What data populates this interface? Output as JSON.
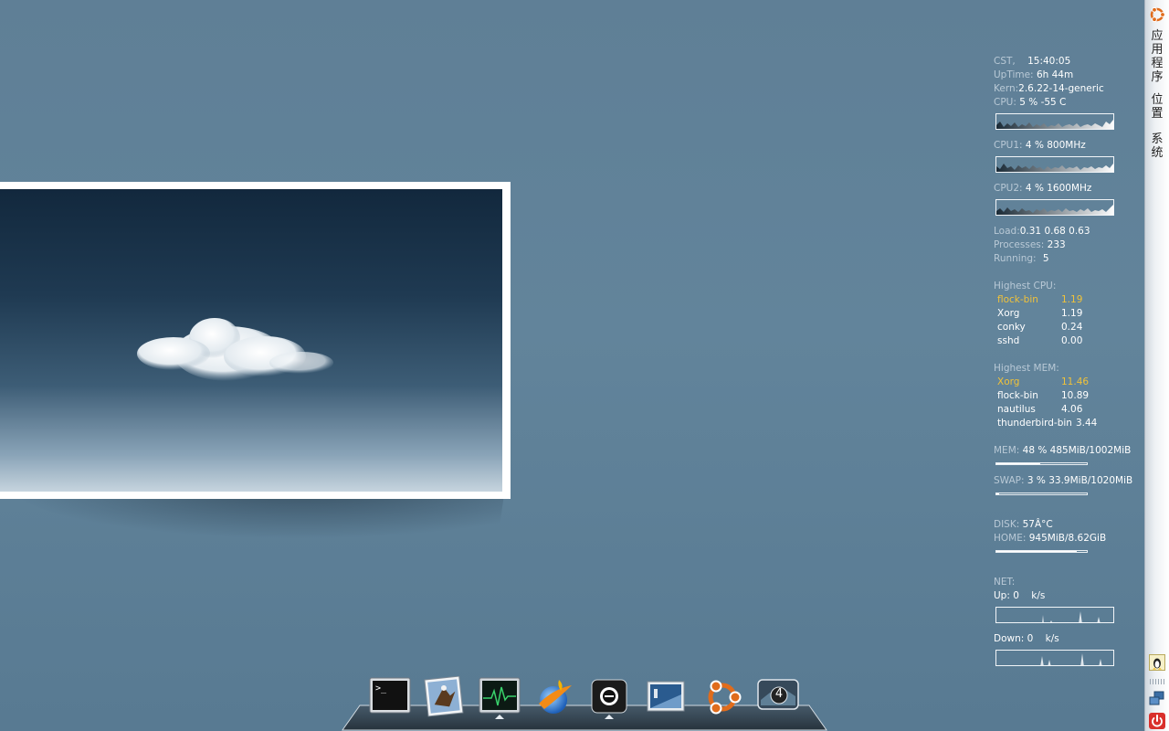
{
  "conky": {
    "clock_label": "CST,",
    "clock_value": "15:40:05",
    "uptime_label": "UpTime:",
    "uptime_value": "6h 44m",
    "kern_label": "Kern:",
    "kern_value": "2.6.22-14-generic",
    "cpu_label": "CPU:",
    "cpu_value": "5  % -55  C",
    "cpu1_label": "CPU1:",
    "cpu1_value": "4  %  800MHz",
    "cpu2_label": "CPU2:",
    "cpu2_value": "4  %  1600MHz",
    "load_label": "Load:",
    "load_value": "0.31 0.68 0.63",
    "processes_label": "Processes:",
    "processes_value": "233",
    "running_label": "Running:",
    "running_value": "5",
    "highest_cpu_label": "Highest CPU:",
    "highest_cpu": [
      {
        "name": "flock-bin",
        "value": "1.19"
      },
      {
        "name": "Xorg",
        "value": "1.19"
      },
      {
        "name": "conky",
        "value": "0.24"
      },
      {
        "name": "sshd",
        "value": "0.00"
      }
    ],
    "highest_mem_label": "Highest MEM:",
    "highest_mem": [
      {
        "name": "Xorg",
        "value": "11.46"
      },
      {
        "name": "flock-bin",
        "value": "10.89"
      },
      {
        "name": "nautilus",
        "value": "4.06"
      },
      {
        "name": "thunderbird-bin",
        "value": "3.44"
      }
    ],
    "mem_label": "MEM:",
    "mem_value": "48 % 485MiB/1002MiB",
    "mem_fraction": 0.48,
    "swap_label": "SWAP:",
    "swap_value": "3  % 33.9MiB/1020MiB",
    "swap_fraction": 0.03,
    "disk_label": "DISK:",
    "disk_value": "57Â°C",
    "home_label": "HOME:",
    "home_value": "945MiB/8.62GiB",
    "home_fraction": 0.89,
    "net_label": "NET:",
    "up_label": "Up: 0",
    "up_unit": "k/s",
    "down_label": "Down: 0",
    "down_unit": "k/s"
  },
  "panel": {
    "menu_applications": "应用程序",
    "menu_places": "位置",
    "menu_system": "系统"
  },
  "dock": {
    "items": [
      {
        "icon": "terminal-icon"
      },
      {
        "icon": "mail-eagle-icon"
      },
      {
        "icon": "system-monitor-icon"
      },
      {
        "icon": "flock-browser-icon"
      },
      {
        "icon": "camera-icon"
      },
      {
        "icon": "display-settings-icon"
      },
      {
        "icon": "ubuntu-icon"
      },
      {
        "icon": "workspace-switcher-icon"
      }
    ],
    "workspace_number": "4"
  },
  "colors": {
    "highlight": "#f0c23a",
    "label": "#b9c9d6"
  }
}
